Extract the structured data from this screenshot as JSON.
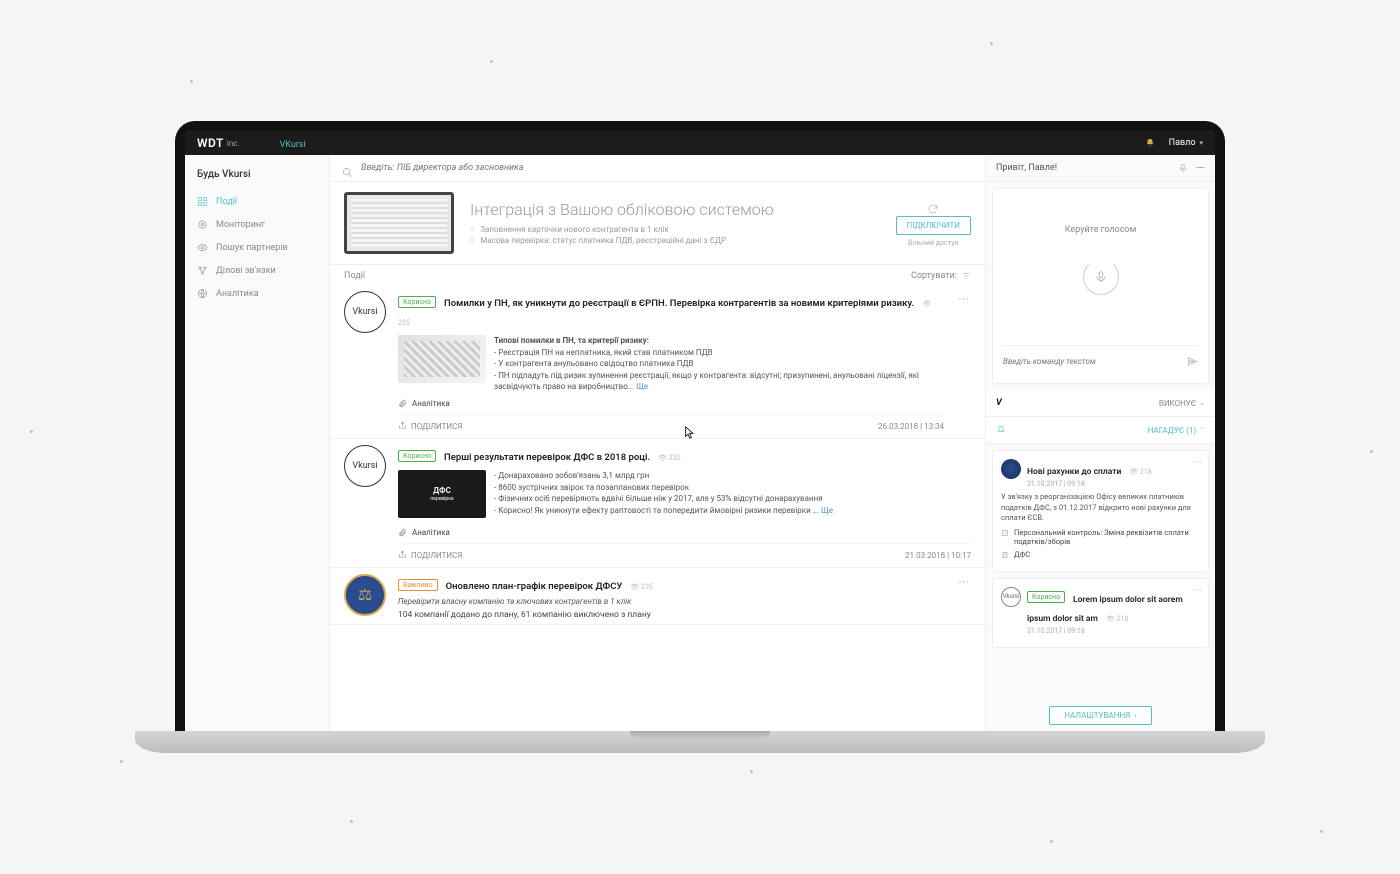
{
  "topbar": {
    "brand": "WDT",
    "brand_sub": "inc.",
    "nav": [
      "VKursi"
    ],
    "user": "Павло"
  },
  "sidebar": {
    "title": "Будь Vkursi",
    "items": [
      {
        "label": "Події"
      },
      {
        "label": "Моніторинг"
      },
      {
        "label": "Пошук партнерів"
      },
      {
        "label": "Ділові зв'язки"
      },
      {
        "label": "Аналітика"
      }
    ]
  },
  "search": {
    "placeholder": "Введіть: ПІБ директора або засновника"
  },
  "promo": {
    "title": "Інтеграція з Вашою обліковою системою",
    "li1": "Заповнення карточки нового контрагента в 1 клік",
    "li2": "Масова перевірка: статус платника ПДВ, реєстраційні дані з ЄДР",
    "button": "ПІДКЛЮЧИТИ",
    "free": "Вільний доступ"
  },
  "feed_head": {
    "events": "Події",
    "sort": "Сортувати:"
  },
  "posts": [
    {
      "avatar_text": "Vkursi",
      "tag": "Корисно",
      "title": "Помилки у ПН, як уникнути до реєстрації в ЄРПН. Перевірка контрагентів за новими критеріями ризику.",
      "views": "235",
      "subhead": "Типові помилки в ПН, та критерії ризику:",
      "l1": "- Реєстрація ПН на неплатника, який став платником ПДВ",
      "l2": "- У контрагента анульовано свідоцтво платника ПДВ",
      "l3": "- ПН підпадуть під ризик зупинення реєстрації, якщо у контрагента: відсутні; призупинені, анульовані ліцензії, які засвідчують право на виробництво...",
      "more": "Ще",
      "attach": "Аналітика",
      "share": "ПОДІЛИТИСЯ",
      "ts": "26.03.2018 | 13:34"
    },
    {
      "avatar_text": "Vkursi",
      "tag": "Корисно",
      "title": "Перші результати перевірок ДФС в 2018 році.",
      "views": "235",
      "thumb_label": "ДФС",
      "thumb_sub": "перевірка",
      "l1": "- Донараховано зобов'язань 3,1 млрд грн",
      "l2": "- 8600 зустрічних звірок та позапланових перевірок",
      "l3": "- Фізичних осіб перевіряють вдвічі більше ніж у 2017, але у 53% відсутні донарахування",
      "l4": "- Корисно! Як уникнути ефекту раптовості та попередити ймовірні ризики перевірки ...",
      "more": "Ще",
      "attach": "Аналітика",
      "share": "ПОДІЛИТИСЯ",
      "ts": "21.03.2018 | 10:17"
    },
    {
      "tag": "Важливо",
      "title": "Оновлено план-графік перевірок ДФСУ",
      "views": "235",
      "sub": "Перевірити власну компанію та ключових контрагентів в 1 клік",
      "line": "104 компанії додано до плану, 61 компанію виключено з плану"
    }
  ],
  "rpane": {
    "greeting": "Привіт, Павле!",
    "voice_hint": "Керуйте голосом",
    "cmd_placeholder": "Введіть команду текстом",
    "row1": {
      "icon_letter": "V",
      "label": "ВИКОНУЄ"
    },
    "row2": {
      "label": "НАГАДУЄ (1)"
    },
    "notifs": [
      {
        "title": "Нові рахунки до сплати",
        "views": "218",
        "date": "31.10.2017 | 09:18",
        "text": "У зв'язку з реорганізацією Офісу великих платників податків ДФС, з 01.12.2017 відкрито нові рахунки для сплати ЄСВ.",
        "meta1": "Персональний контроль:  Зміна реквізитів сплати податків/зборів",
        "meta2": "ДФС"
      },
      {
        "tag": "Корисно",
        "title": "Lorem ipsum dolor sit aorem ipsum dolor sit am",
        "views": "218",
        "date": "31.10.2017 | 09:18",
        "avatar_text": "Vkursi"
      }
    ],
    "settings": "НАЛАШТУВАННЯ"
  }
}
